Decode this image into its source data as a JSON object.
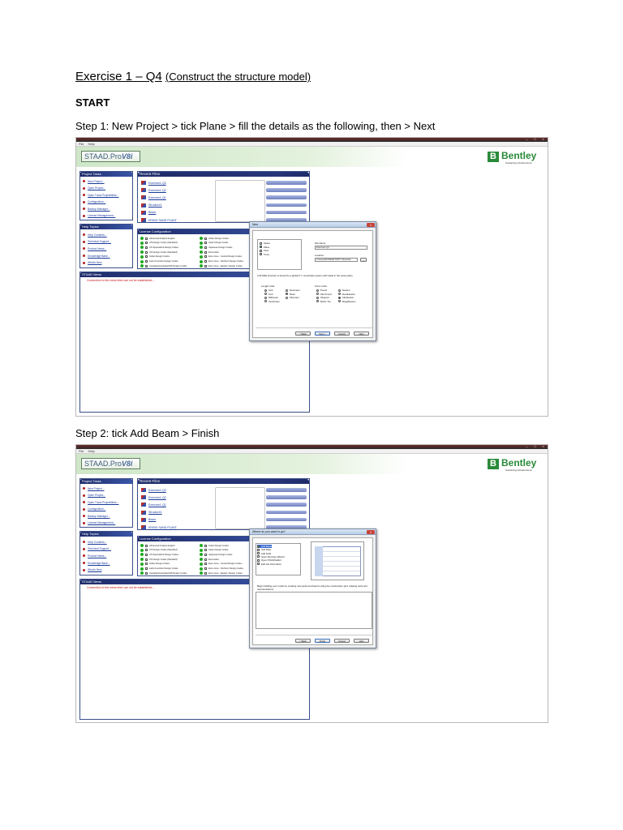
{
  "document": {
    "heading": "Exercise 1 – Q4",
    "heading_sub": "(Construct the structure model)",
    "start": "START",
    "step1": "Step 1: New Project > tick Plane > fill the details as the following, then > Next",
    "step2": "Step 2: tick Add Beam > Finish"
  },
  "app": {
    "menu": [
      "File",
      "Help"
    ],
    "window_buttons": [
      "–",
      "□",
      "×"
    ],
    "logo_text": "STAAD.Pro",
    "logo_version": "V8i",
    "brand_mark": "B",
    "brand_name": "Bentley",
    "brand_tagline": "Sustaining Infrastructure",
    "project_tasks": {
      "title": "Project Tasks",
      "items": [
        "New Project...",
        "Open Project...",
        "Open Trans ProjectWise...",
        "Configuration...",
        "Backup Manager...",
        "License Management..."
      ]
    },
    "help_topics": {
      "title": "Help Topics",
      "items": [
        "Help Contents...",
        "Technical Support...",
        "Product News...",
        "Knowledge Base...",
        "What's New"
      ]
    },
    "news": {
      "title": "STAAD News",
      "error": "Connection to the news feed can not be established...."
    },
    "recent_files": {
      "title": "Recent Files",
      "items": [
        "Exercise1-Q3",
        "Exercise1-Q2",
        "Exercise1-Q1",
        "Structure1",
        "Beam",
        "KRING SAND PLANT"
      ]
    },
    "license": {
      "title": "License Configuration",
      "left": [
        "Advanced Analysis Engine",
        "US Design Codes (Standard)",
        "US Specialized Design Codes",
        "UK Design Codes (Standard)",
        "Indian Design Codes",
        "Latin American Design Codes",
        "Canadian/Australian/NZ Design Codes"
      ],
      "right": [
        "Indian Design Codes",
        "Asian Design Codes",
        "Japanese Design Codes",
        "Eurocodes",
        "Euro-zone - Central Design Codes",
        "Euro-zone - Northern Design Codes",
        "Euro-zone - Eastern Design Codes"
      ]
    }
  },
  "dialog1": {
    "title": "New",
    "close": "×",
    "structure_types": [
      {
        "label": "Space",
        "checked": false
      },
      {
        "label": "Plane",
        "checked": true
      },
      {
        "label": "Floor",
        "checked": false
      },
      {
        "label": "Truss",
        "checked": false
      }
    ],
    "file_name_label": "File Name:",
    "file_name_value": "Exercise1-Q4",
    "location_label": "Location:",
    "location_value": "C:\\Users\\KC\\DESKTOP\\T T Exercise",
    "browse": "...",
    "description": "A PLANE structure is bound by a global X-Y coordinate system with loads in the same plane.",
    "length_units_label": "Length Units:",
    "length_units": [
      {
        "label": "Inch",
        "on": false
      },
      {
        "label": "Decimeter",
        "on": false
      },
      {
        "label": "Foot",
        "on": false
      },
      {
        "label": "Meter",
        "on": true
      },
      {
        "label": "Millimeter",
        "on": false
      },
      {
        "label": "Kilometer",
        "on": false
      },
      {
        "label": "Centimeter",
        "on": false
      }
    ],
    "force_units_label": "Force Units:",
    "force_units": [
      {
        "label": "Pound",
        "on": false
      },
      {
        "label": "Newton",
        "on": false
      },
      {
        "label": "Kilo Pound",
        "on": false
      },
      {
        "label": "DecaNewton",
        "on": false
      },
      {
        "label": "Kilogram",
        "on": false
      },
      {
        "label": "KiloNewton",
        "on": true
      },
      {
        "label": "Metric Ton",
        "on": false
      },
      {
        "label": "MegaNewton",
        "on": false
      }
    ],
    "buttons": [
      "< Back",
      "Next >",
      "Cancel",
      "Help"
    ]
  },
  "dialog2": {
    "title": "Where do you want to go?",
    "close": "×",
    "options": [
      "Add Beam",
      "Add Plate",
      "Add Solid",
      "Open Structure Wizard",
      "Open STAAD Editor",
      "Edit Job Information"
    ],
    "description": "Begin building your model by creating new joints and beams using the construction grid, drawing tools and representations.",
    "buttons": [
      "< Back",
      "Finish",
      "Cancel",
      "Help"
    ]
  },
  "colors": {
    "panel_header": "#1f2c6a",
    "link": "#1a3a9a",
    "error_text": "#c01010",
    "bentley_green": "#2a8a3a",
    "license_ok": "#22aa22"
  }
}
